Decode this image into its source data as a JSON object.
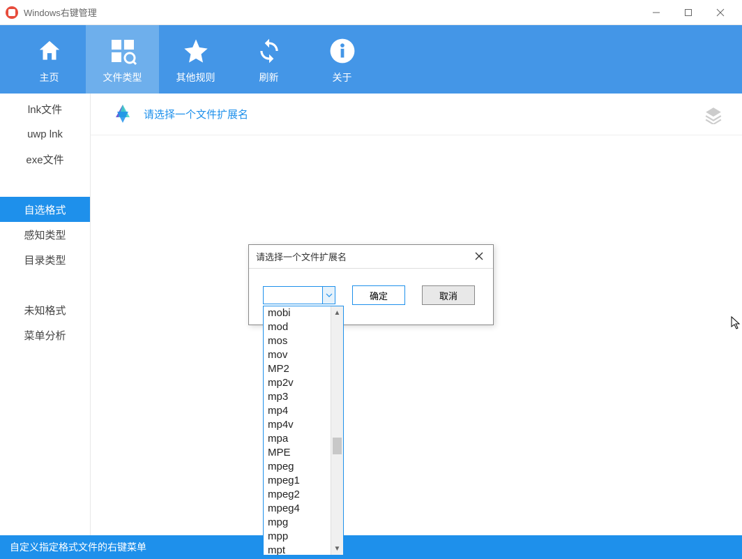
{
  "window": {
    "title": "Windows右键管理"
  },
  "toolbar": {
    "home": "主页",
    "filetype": "文件类型",
    "otherrules": "其他规则",
    "refresh": "刷新",
    "about": "关于"
  },
  "sidebar": {
    "lnk": "lnk文件",
    "uwplnk": "uwp lnk",
    "exe": "exe文件",
    "custom": "自选格式",
    "perceived": "感知类型",
    "directory": "目录类型",
    "unknown": "未知格式",
    "menuanalysis": "菜单分析"
  },
  "content": {
    "hint": "请选择一个文件扩展名"
  },
  "dialog": {
    "title": "请选择一个文件扩展名",
    "ok": "确定",
    "cancel": "取消",
    "value": ""
  },
  "dropdown": {
    "items": [
      "mobi",
      "mod",
      "mos",
      "mov",
      "MP2",
      "mp2v",
      "mp3",
      "mp4",
      "mp4v",
      "mpa",
      "MPE",
      "mpeg",
      "mpeg1",
      "mpeg2",
      "mpeg4",
      "mpg",
      "mpp",
      "mpt"
    ]
  },
  "statusbar": {
    "text": "自定义指定格式文件的右键菜单"
  }
}
